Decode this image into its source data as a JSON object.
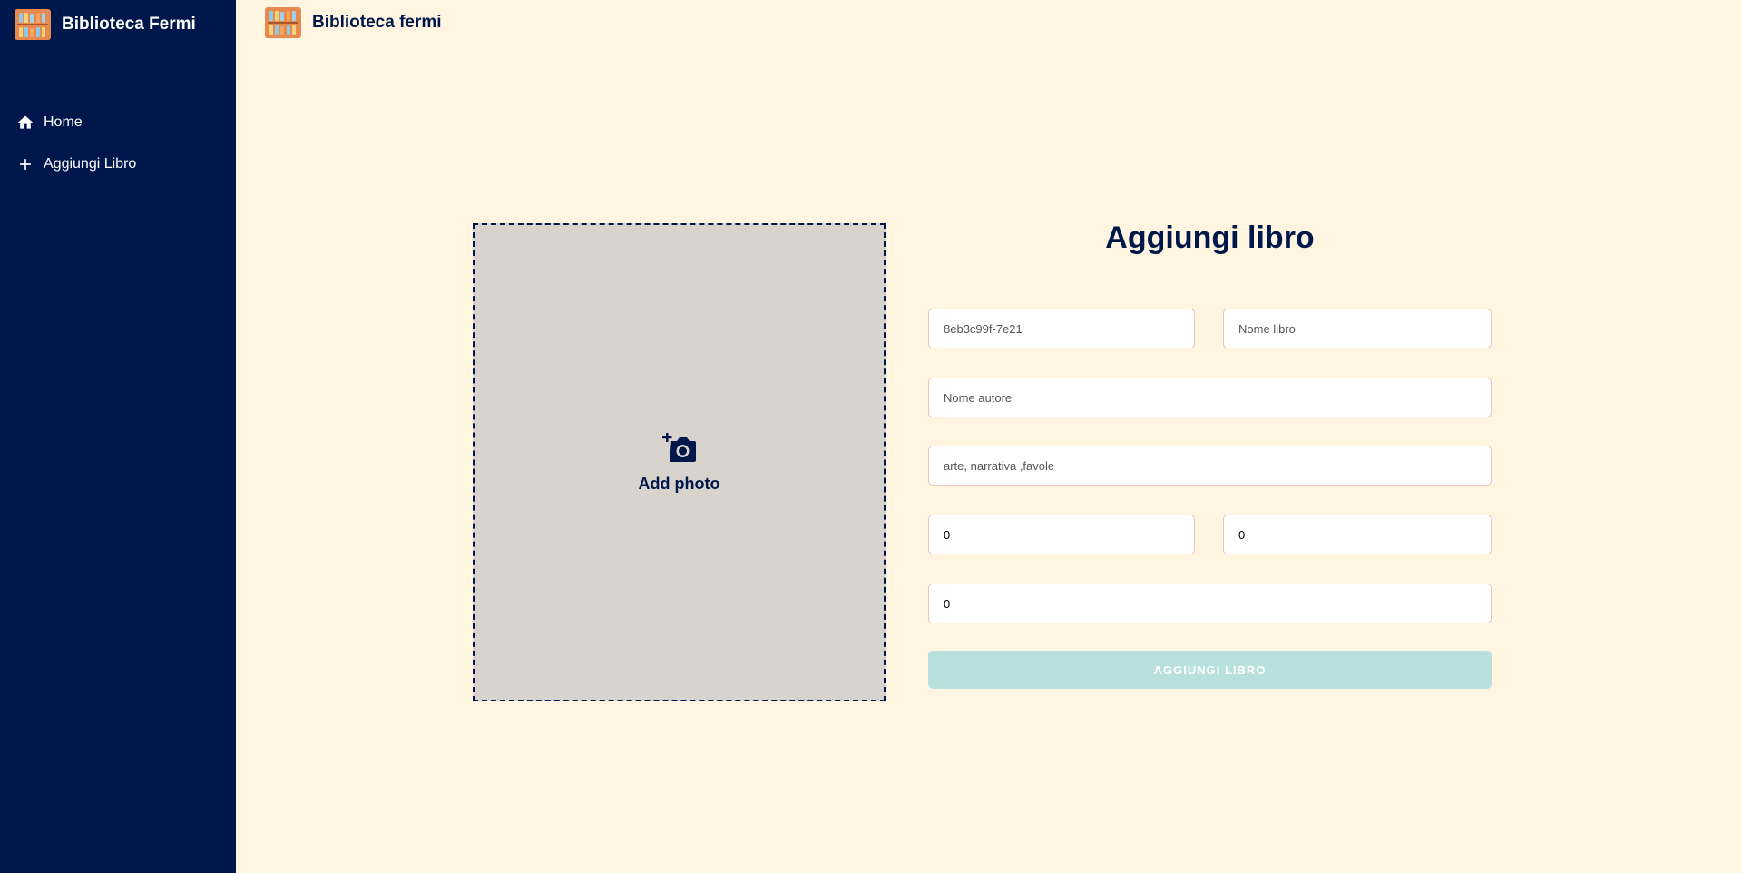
{
  "sidebar": {
    "brand_title": "Biblioteca Fermi",
    "nav": [
      {
        "label": "Home",
        "icon": "home-icon"
      },
      {
        "label": "Aggiungi Libro",
        "icon": "plus-icon"
      }
    ]
  },
  "topbar": {
    "title": "Biblioteca fermi"
  },
  "photo": {
    "label": "Add photo",
    "icon": "add-photo-icon"
  },
  "form": {
    "title": "Aggiungi libro",
    "fields": {
      "id": {
        "value": "",
        "placeholder": "8eb3c99f-7e21"
      },
      "book_name": {
        "value": "",
        "placeholder": "Nome libro"
      },
      "author": {
        "value": "",
        "placeholder": "Nome autore"
      },
      "genres": {
        "value": "",
        "placeholder": "arte, narrativa ,favole"
      },
      "number_a": {
        "value": "0",
        "placeholder": ""
      },
      "number_b": {
        "value": "0",
        "placeholder": ""
      },
      "number_c": {
        "value": "0",
        "placeholder": ""
      }
    },
    "submit_label": "AGGIUNGI LIBRO"
  },
  "colors": {
    "sidebar_bg": "#00174b",
    "page_bg": "#fff5e1",
    "accent": "#00174b",
    "button_disabled": "#b8e0de"
  }
}
